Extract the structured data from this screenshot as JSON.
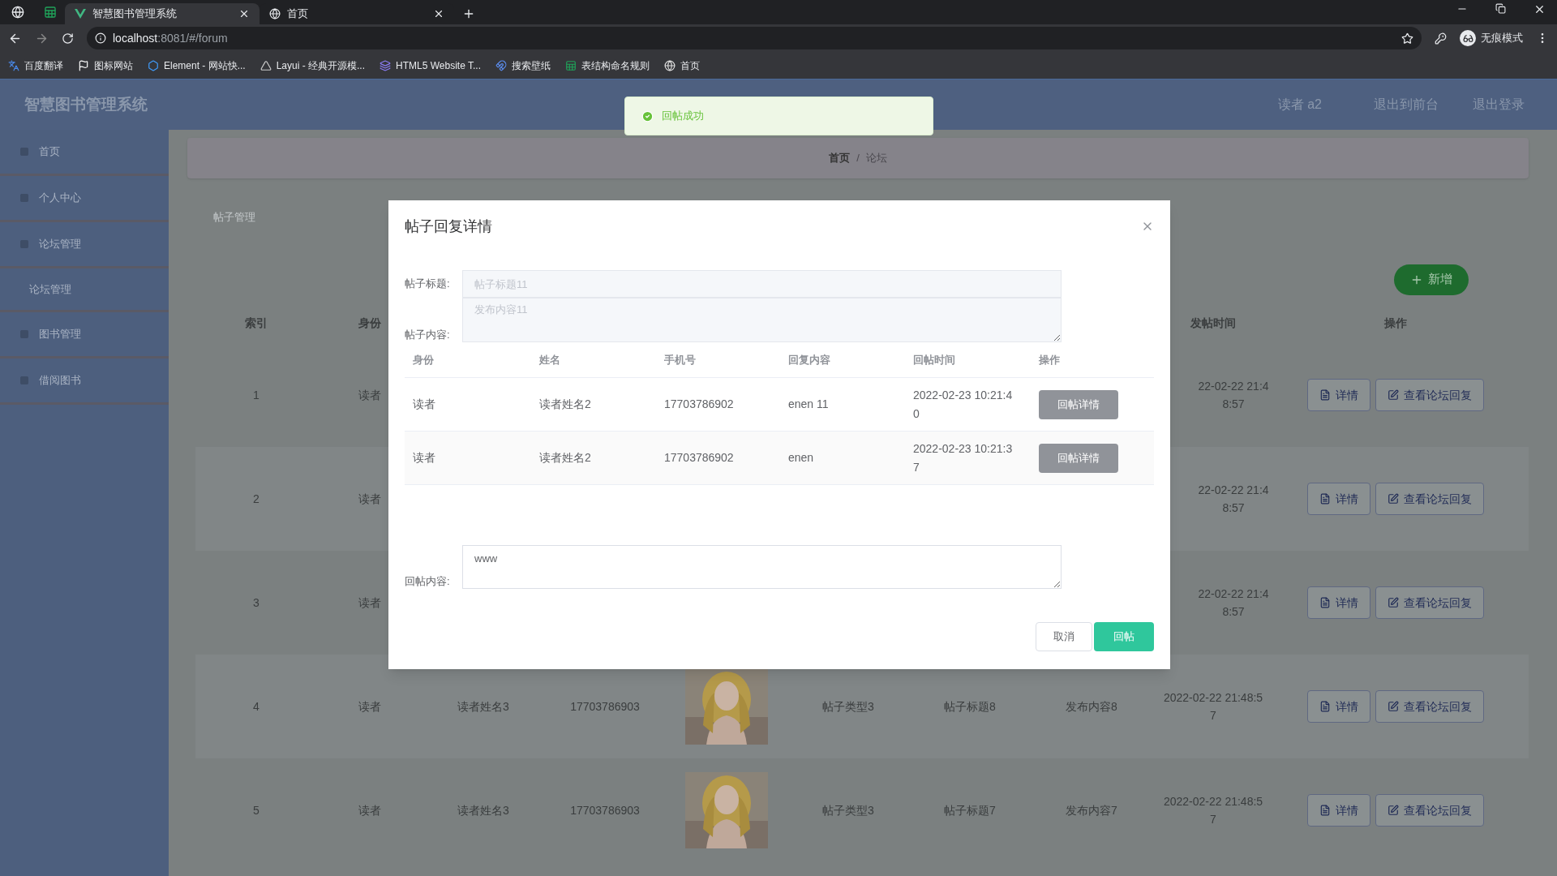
{
  "browser": {
    "tabs": [
      {
        "title": "智慧图书管理系统",
        "selected": true
      },
      {
        "title": "首页",
        "selected": false
      }
    ],
    "address": {
      "host": "localhost",
      "path": ":8081/#/forum"
    },
    "bookmarks": [
      "百度翻译",
      "图标网站",
      "Element - 网站快...",
      "Layui - 经典开源模...",
      "HTML5 Website T...",
      "搜索壁纸",
      "表结构命名规则",
      "首页"
    ],
    "profile": "无痕模式"
  },
  "app": {
    "title": "智慧图书管理系统",
    "user": "读者 a2",
    "links": [
      "退出到前台",
      "退出登录"
    ]
  },
  "sidebar": {
    "items": [
      {
        "label": "首页"
      },
      {
        "label": "个人中心"
      },
      {
        "label": "论坛管理",
        "children": [
          {
            "label": "论坛管理"
          }
        ]
      },
      {
        "label": "图书管理"
      },
      {
        "label": "借阅图书"
      }
    ]
  },
  "breadcrumb": {
    "items": [
      "首页",
      "论坛"
    ],
    "separator": "/"
  },
  "card": {
    "title": "帖子管理",
    "add_button": "新增",
    "columns": [
      "索引",
      "身份",
      "发帖时间",
      "操作"
    ],
    "rows": [
      {
        "kind": "partial",
        "index": "1",
        "role": "读者",
        "time": "22-02-22 21:48:57",
        "actions": [
          "详情",
          "查看论坛回复"
        ]
      },
      {
        "kind": "partial",
        "index": "2",
        "role": "读者",
        "time": "22-02-22 21:48:57",
        "actions": [
          "详情",
          "查看论坛回复"
        ]
      },
      {
        "kind": "partial",
        "index": "3",
        "role": "读者",
        "time": "22-02-22 21:48:57",
        "actions": [
          "详情",
          "查看论坛回复"
        ]
      },
      {
        "kind": "full",
        "index": "4",
        "role": "读者",
        "name": "读者姓名3",
        "phone": "17703786903",
        "type": "帖子类型3",
        "title": "帖子标题8",
        "content": "发布内容8",
        "time": "2022-02-22 21:48:57",
        "actions": [
          "详情",
          "查看论坛回复"
        ]
      },
      {
        "kind": "full",
        "index": "5",
        "role": "读者",
        "name": "读者姓名3",
        "phone": "17703786903",
        "type": "帖子类型3",
        "title": "帖子标题7",
        "content": "发布内容7",
        "time": "2022-02-22 21:48:57",
        "actions": [
          "详情",
          "查看论坛回复"
        ]
      }
    ]
  },
  "toast": {
    "message": "回帖成功"
  },
  "dialog": {
    "title": "帖子回复详情",
    "fields": [
      {
        "label": "帖子标题:",
        "placeholder": "帖子标题11"
      },
      {
        "label": "帖子内容:",
        "placeholder": "发布内容11"
      }
    ],
    "columns": [
      "身份",
      "姓名",
      "手机号",
      "回复内容",
      "回帖时间",
      "操作"
    ],
    "rows": [
      {
        "role": "读者",
        "name": "读者姓名2",
        "phone": "17703786902",
        "content": "enen 11",
        "time": "2022-02-23 10:21:40",
        "action": "回帖详情"
      },
      {
        "role": "读者",
        "name": "读者姓名2",
        "phone": "17703786902",
        "content": "enen",
        "time": "2022-02-23 10:21:37",
        "action": "回帖详情"
      }
    ],
    "reply": {
      "label": "回帖内容:",
      "value": "www"
    },
    "buttons": [
      "取消",
      "回帖"
    ]
  }
}
